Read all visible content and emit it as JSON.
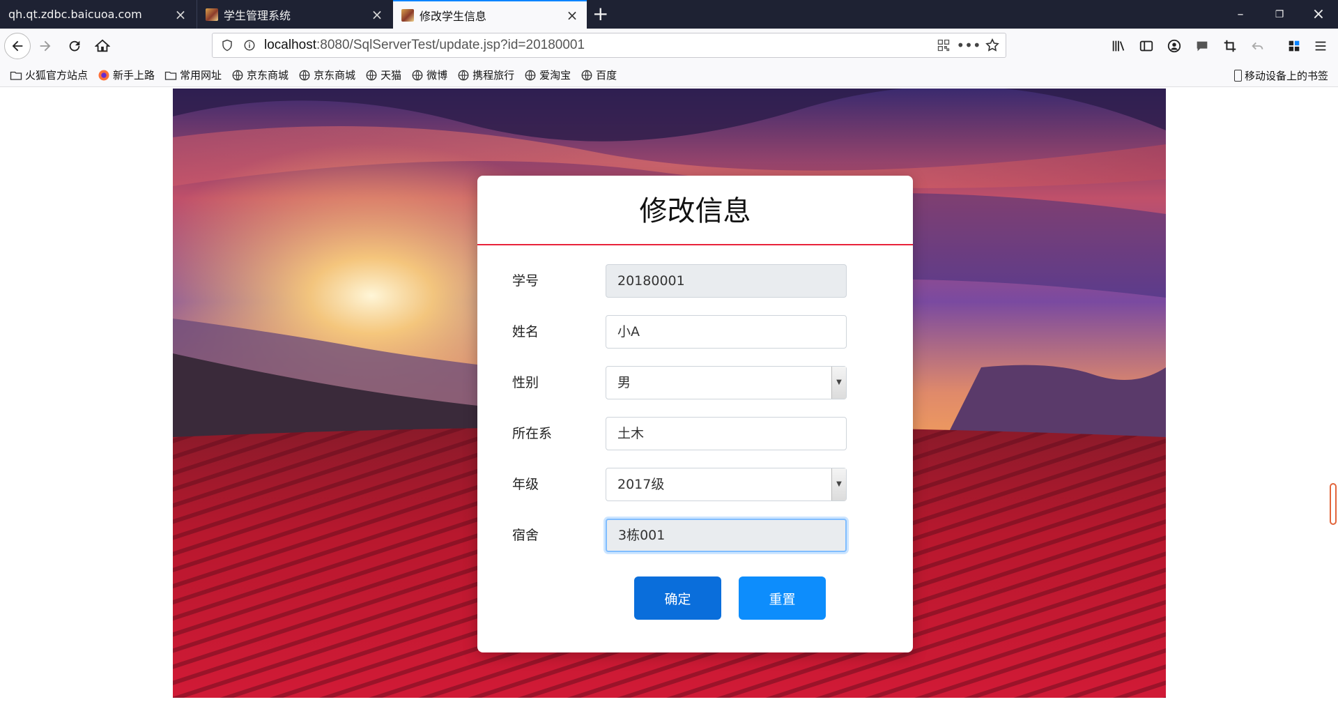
{
  "browser": {
    "tabs": [
      {
        "label": "qh.qt.zdbc.baicuoa.com"
      },
      {
        "label": "学生管理系统"
      },
      {
        "label": "修改学生信息"
      }
    ],
    "url": {
      "host": "localhost",
      "rest": ":8080/SqlServerTest/update.jsp?id=20180001"
    },
    "bookmarks": [
      "火狐官方站点",
      "新手上路",
      "常用网址",
      "京东商城",
      "京东商城",
      "天猫",
      "微博",
      "携程旅行",
      "爱淘宝",
      "百度"
    ],
    "mobile_bookmarks": "移动设备上的书签"
  },
  "form": {
    "title": "修改信息",
    "fields": [
      {
        "label": "学号",
        "value": "20180001"
      },
      {
        "label": "姓名",
        "value": "小A"
      },
      {
        "label": "性别",
        "value": "男"
      },
      {
        "label": "所在系",
        "value": "土木"
      },
      {
        "label": "年级",
        "value": "2017级"
      },
      {
        "label": "宿舍",
        "value": "3栋001"
      }
    ],
    "submit": "确定",
    "reset": "重置"
  },
  "colors": {
    "accent": "#e8223a",
    "primary": "#0a6edb",
    "secondary": "#0d8dfc",
    "tabbar": "#1e2233"
  }
}
